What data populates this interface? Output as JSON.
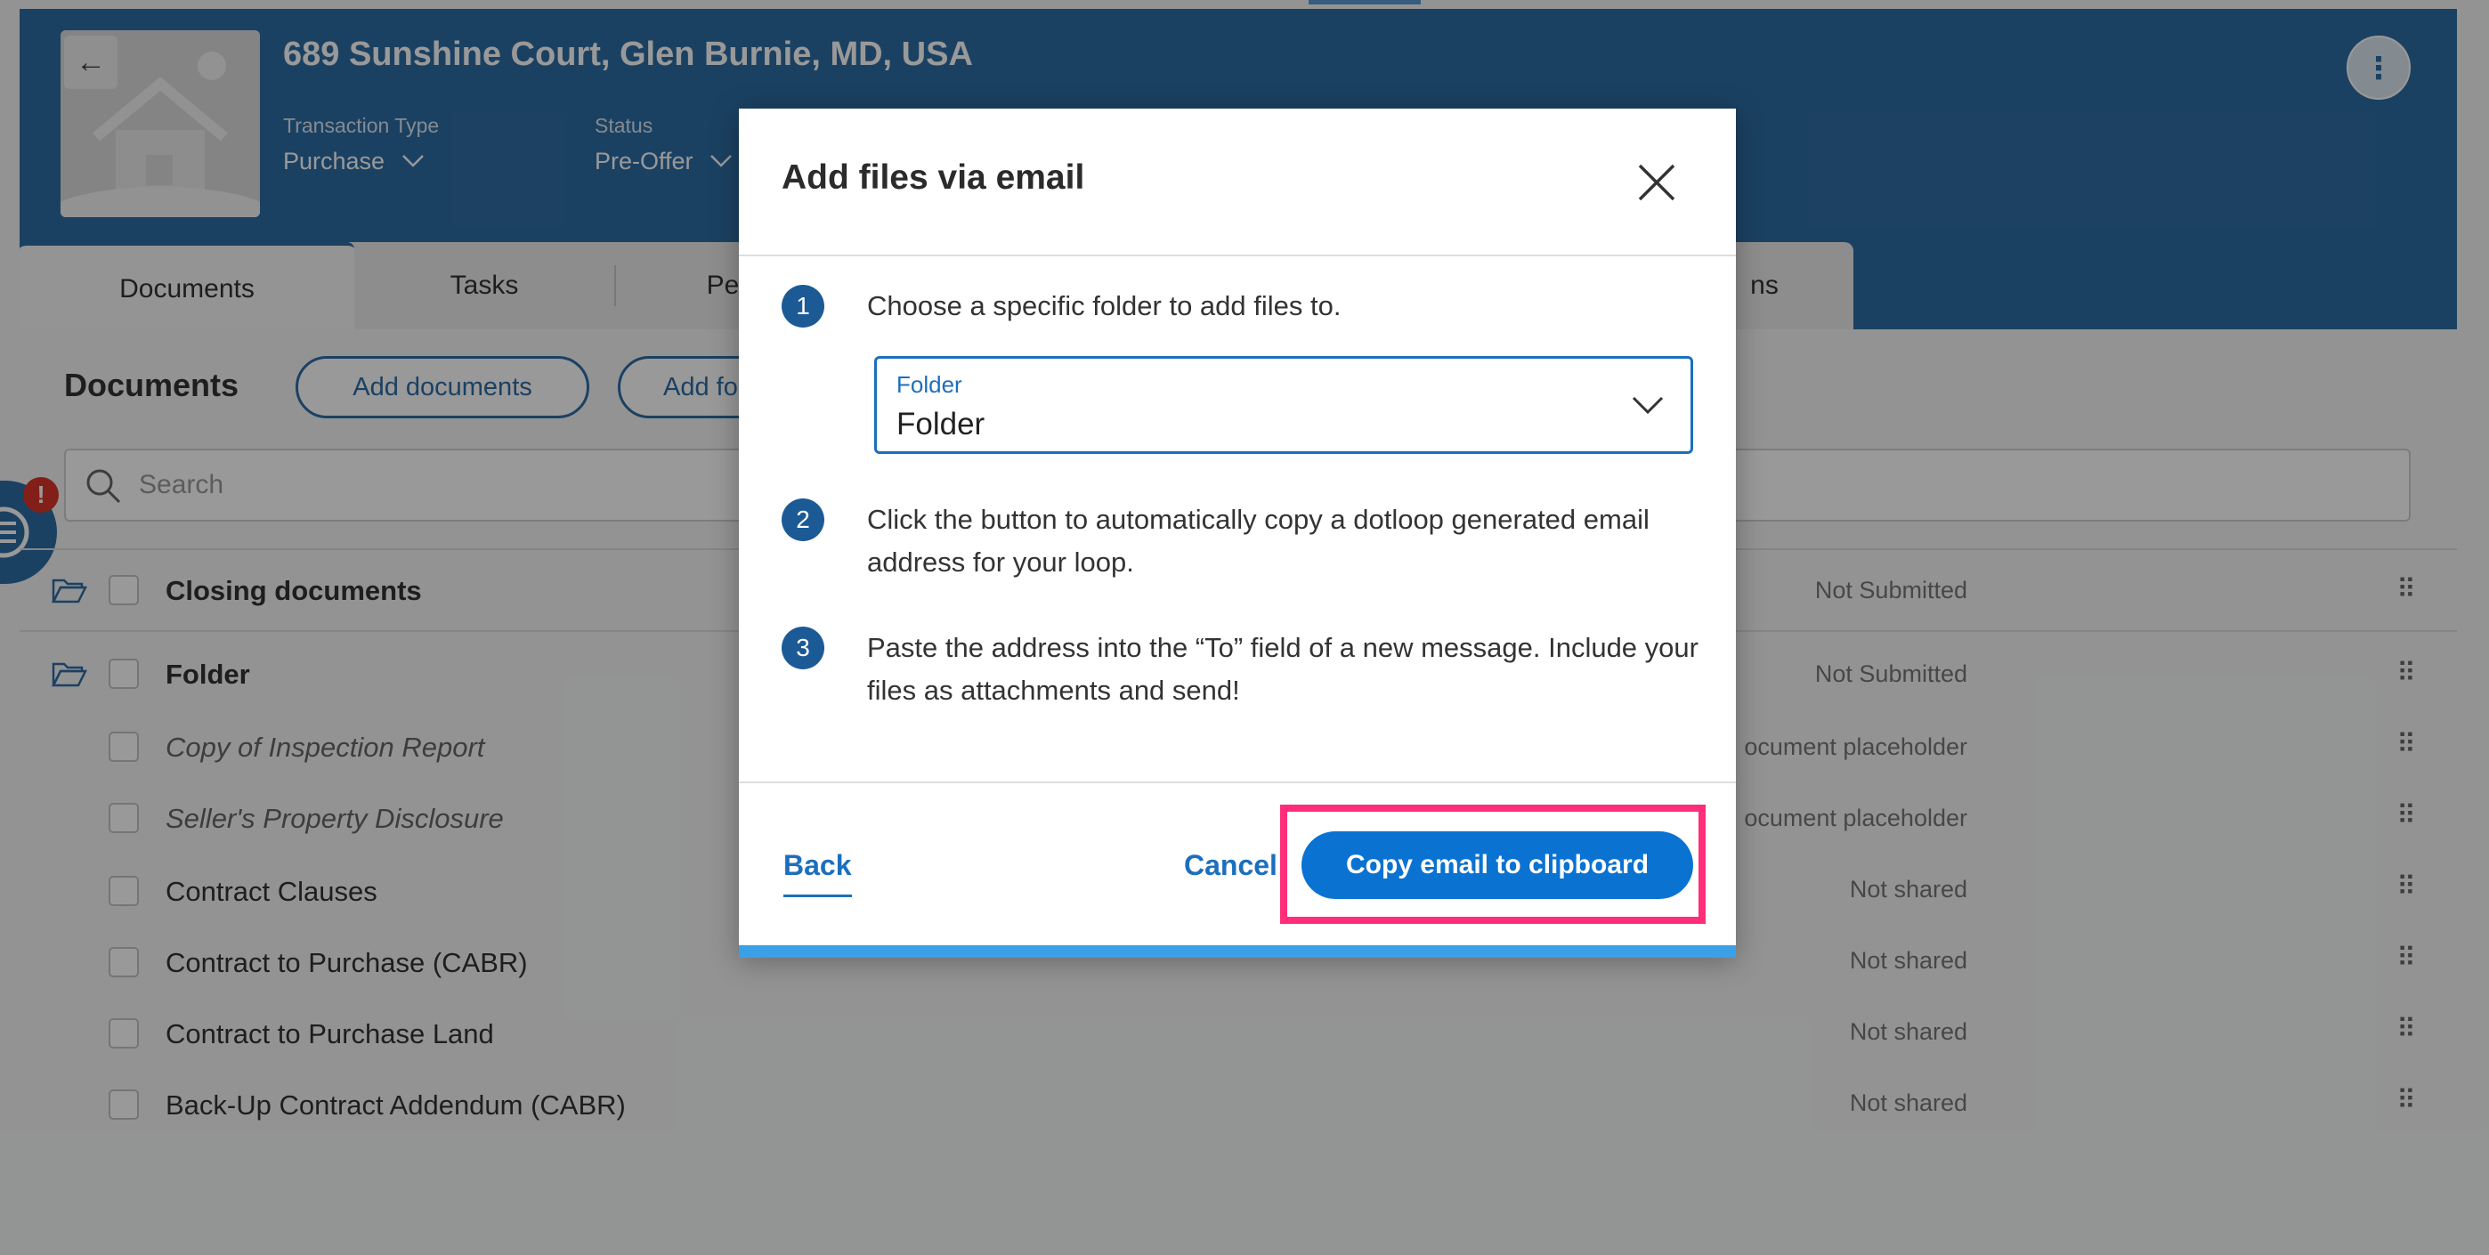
{
  "header": {
    "address": "689 Sunshine Court, Glen Burnie, MD, USA",
    "transaction_type_label": "Transaction Type",
    "transaction_type_value": "Purchase",
    "status_label": "Status",
    "status_value": "Pre-Offer",
    "back_icon": "arrow-left-icon",
    "more_icon": "vertical-dots-icon"
  },
  "tabs": [
    {
      "label": "Documents",
      "active": true
    },
    {
      "label": "Tasks"
    },
    {
      "label": "Pe"
    },
    {
      "label": "ns"
    }
  ],
  "documents": {
    "title": "Documents",
    "add_documents_label": "Add documents",
    "add_folder_label": "Add fo",
    "search_placeholder": "Search",
    "notification_badge": "!",
    "rows": [
      {
        "name": "Closing documents",
        "status": "Not Submitted",
        "type": "folder"
      },
      {
        "name": "Folder",
        "status": "Not Submitted",
        "type": "folder"
      },
      {
        "name": "Copy of Inspection Report",
        "status": "ocument placeholder",
        "type": "placeholder"
      },
      {
        "name": "Seller's Property Disclosure",
        "status": "ocument placeholder",
        "type": "placeholder"
      },
      {
        "name": "Contract Clauses",
        "status": "Not shared",
        "type": "doc"
      },
      {
        "name": "Contract to Purchase (CABR)",
        "status": "Not shared",
        "type": "doc"
      },
      {
        "name": "Contract to Purchase Land",
        "status": "Not shared",
        "type": "doc"
      },
      {
        "name": "Back-Up Contract Addendum (CABR)",
        "status": "Not shared",
        "type": "doc"
      }
    ]
  },
  "modal": {
    "title": "Add files via email",
    "close_icon": "close-icon",
    "steps": [
      {
        "num": "1",
        "text": "Choose a specific folder to add files to."
      },
      {
        "num": "2",
        "text": "Click the button to automatically copy a dotloop generated email address for your loop."
      },
      {
        "num": "3",
        "text": "Paste the address into the “To” field of a new message. Include your files as attachments and send!"
      }
    ],
    "folder_select": {
      "label": "Folder",
      "value": "Folder"
    },
    "back_label": "Back",
    "cancel_label": "Cancel",
    "copy_label": "Copy email to clipboard"
  },
  "colors": {
    "header": "#2e6da4",
    "primary": "#0a72d1",
    "highlight": "#ff2d7a",
    "badge": "#d9342b"
  }
}
